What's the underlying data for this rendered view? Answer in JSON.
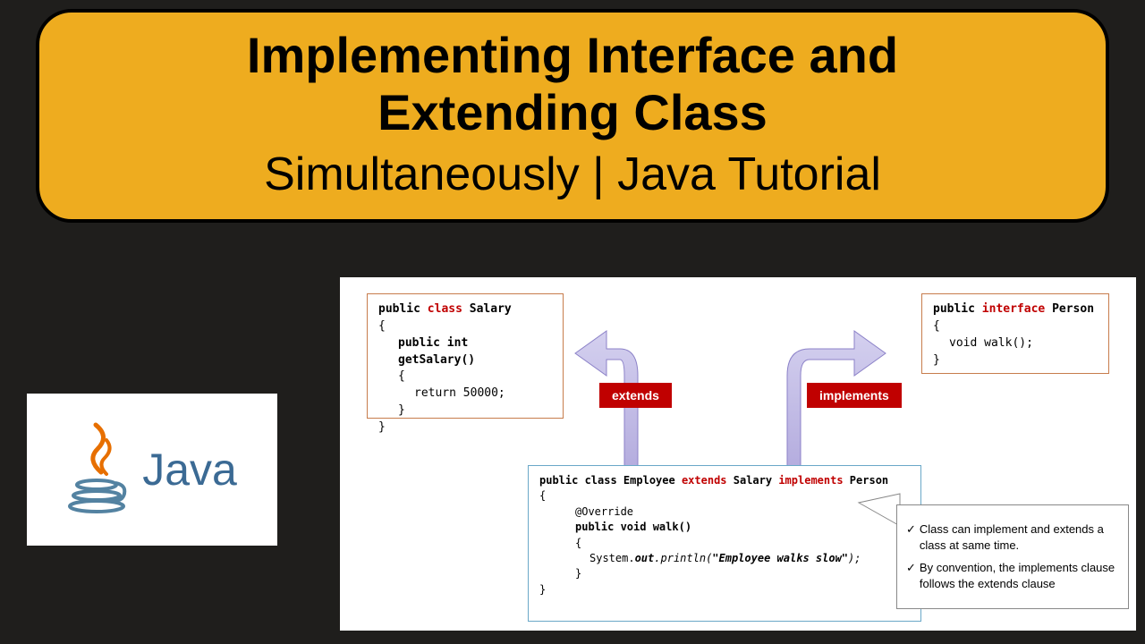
{
  "title": {
    "line1a": "Implementing Interface and",
    "line1b": "Extending Class",
    "line2": "Simultaneously | Java Tutorial"
  },
  "logo": {
    "text": "Java"
  },
  "salary": {
    "decl_pre": "public ",
    "decl_kw": "class",
    "decl_post": " Salary",
    "open": "{",
    "method": "public int getSalary()",
    "method_open": "{",
    "ret": "return 50000;",
    "method_close": "}",
    "close": "}"
  },
  "person": {
    "decl_pre": "public ",
    "decl_kw": "interface",
    "decl_post": " Person",
    "open": "{",
    "method": "void walk();",
    "close": "}"
  },
  "tags": {
    "extends": "extends",
    "implements": "implements"
  },
  "employee": {
    "decl_pre": "public class Employee ",
    "kw_ext": "extends",
    "mid": " Salary ",
    "kw_impl": "implements",
    "post": " Person",
    "open": "{",
    "override": "@Override",
    "method": "public void walk()",
    "method_open": "{",
    "body_pre": "System.",
    "body_out": "out",
    "body_mid": ".println(",
    "body_str": "\"Employee walks slow\"",
    "body_end": ");",
    "method_close": "}",
    "close": "}"
  },
  "notes": {
    "n1": "Class can implement and extends a class at same time.",
    "n2": "By convention, the implements clause follows the extends clause"
  }
}
